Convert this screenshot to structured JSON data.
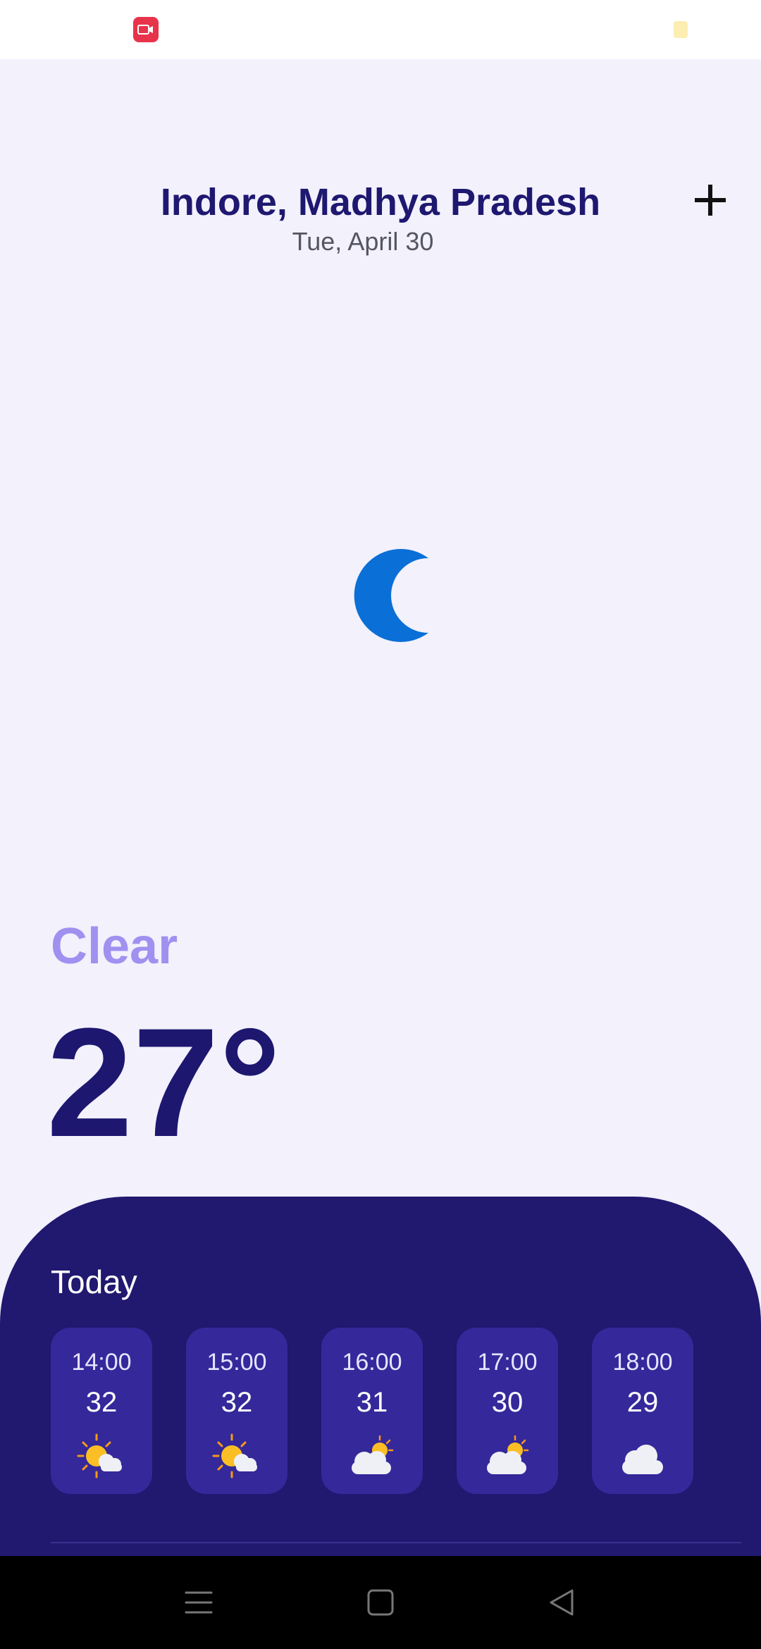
{
  "colors": {
    "background": "#f2f1fc",
    "title": "#1f1870",
    "condition": "#a090f0",
    "panel": "#21186f",
    "card": "#35289a",
    "moon": "#0a6fd6"
  },
  "status_bar": {
    "left_icon": "screen-record-icon",
    "right_icon": "note-icon"
  },
  "header": {
    "location": "Indore, Madhya Pradesh",
    "date": "Tue, April 30",
    "add_icon": "plus-icon"
  },
  "current": {
    "icon": "moon-icon",
    "condition": "Clear",
    "temperature": "27°"
  },
  "today": {
    "title": "Today",
    "hours": [
      {
        "time": "14:00",
        "temp": "32",
        "icon": "sun-cloud-icon"
      },
      {
        "time": "15:00",
        "temp": "32",
        "icon": "sun-cloud-icon"
      },
      {
        "time": "16:00",
        "temp": "31",
        "icon": "cloud-sun-icon"
      },
      {
        "time": "17:00",
        "temp": "30",
        "icon": "cloud-sun-icon"
      },
      {
        "time": "18:00",
        "temp": "29",
        "icon": "cloud-icon"
      }
    ]
  },
  "nav": {
    "recents_icon": "menu-icon",
    "home_icon": "home-square-icon",
    "back_icon": "back-triangle-icon"
  }
}
